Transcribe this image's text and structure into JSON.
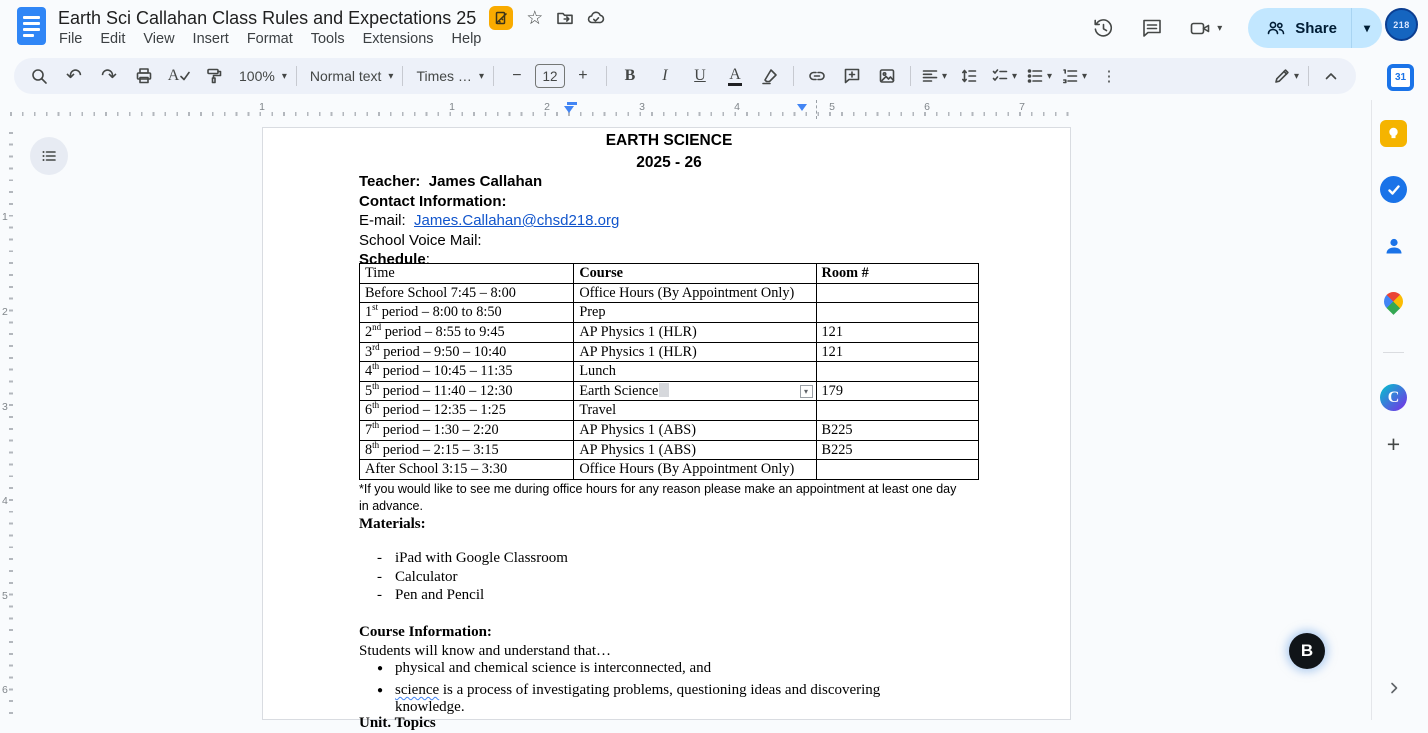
{
  "titlebar": {
    "title": "Earth Sci Callahan Class Rules and Expectations 25",
    "menus": [
      "File",
      "Edit",
      "View",
      "Insert",
      "Format",
      "Tools",
      "Extensions",
      "Help"
    ],
    "share_label": "Share",
    "avatar_badge": "218"
  },
  "toolbar": {
    "zoom_value": "100%",
    "style_value": "Normal text",
    "font_value": "Times …",
    "font_size": "12",
    "bold": "B",
    "italic": "I",
    "underline": "U",
    "text_color": "A",
    "minus": "−",
    "plus": "+",
    "overflow": "⋮",
    "undo": "↶",
    "redo": "↷",
    "spell_letter": "A",
    "star": "☆",
    "calendar_day": "31",
    "canva_letter": "C",
    "brisk_letter": "B",
    "dropdown_glyph": "▾"
  },
  "ruler": {
    "h_numbers": [
      "1",
      "1",
      "2",
      "3",
      "4",
      "5",
      "6",
      "7"
    ],
    "v_numbers": [
      "1",
      "2",
      "3",
      "4",
      "5",
      "6"
    ]
  },
  "document": {
    "heading1": "EARTH SCIENCE",
    "heading2": "2025 - 26",
    "teacher_line": "Teacher:  James Callahan",
    "contact_line": "Contact Information:",
    "email_label": "E-mail:  ",
    "email_link": "James.Callahan@chsd218.org",
    "voicemail_line": "School Voice Mail:",
    "schedule_label": "Schedule",
    "schedule_colon": ":",
    "table": {
      "header": {
        "time": "Time",
        "course": "Course",
        "room": "Room #"
      },
      "rows": [
        {
          "time": {
            "pre": "Before School 7:45 – 8:00"
          },
          "course": "Office Hours (By Appointment Only)",
          "room": ""
        },
        {
          "time": {
            "pre": "1",
            "sup": "st",
            "post": " period – 8:00 to 8:50"
          },
          "course": "Prep",
          "room": ""
        },
        {
          "time": {
            "pre": "2",
            "sup": "nd",
            "post": " period – 8:55 to 9:45"
          },
          "course": "AP Physics 1 (HLR)",
          "room": "121"
        },
        {
          "time": {
            "pre": "3",
            "sup": "rd",
            "post": " period – 9:50 – 10:40"
          },
          "course": "AP Physics 1 (HLR)",
          "room": "121"
        },
        {
          "time": {
            "pre": "4",
            "sup": "th",
            "post": " period – 10:45 – 11:35"
          },
          "course": "Lunch",
          "room": ""
        },
        {
          "time": {
            "pre": "5",
            "sup": "th",
            "post": " period – 11:40 – 12:30"
          },
          "course": "Earth Science",
          "room": "179",
          "selected": true
        },
        {
          "time": {
            "pre": "6",
            "sup": "th",
            "post": " period – 12:35 – 1:25"
          },
          "course": "Travel",
          "room": ""
        },
        {
          "time": {
            "pre": "7",
            "sup": "th",
            "post": " period – 1:30 – 2:20"
          },
          "course": "AP Physics 1 (ABS)",
          "room": "B225"
        },
        {
          "time": {
            "pre": "8",
            "sup": "th",
            "post": " period – 2:15 – 3:15"
          },
          "course": "AP Physics 1 (ABS)",
          "room": "B225"
        },
        {
          "time": {
            "pre": "After School 3:15 – 3:30"
          },
          "course": "Office Hours (By Appointment Only)",
          "room": ""
        }
      ]
    },
    "footnote": "*If you would like to see me during office hours for any reason please make an appointment at least one day in advance.",
    "materials_label": "Materials:",
    "materials": [
      "iPad with Google Classroom",
      "Calculator",
      "Pen and Pencil"
    ],
    "materials_dash": "-",
    "course_info_label": "Course Information:",
    "course_intro": "Students will know and understand that…",
    "bullet_glyph": "●",
    "bullets": [
      {
        "text": "physical and chemical science is interconnected, and"
      },
      {
        "squiggle": "science",
        "text": " is a process of investigating problems, questioning ideas and discovering knowledge."
      }
    ],
    "partial_line": "Unit. Topics"
  },
  "side_panel": {
    "icons": [
      "calendar",
      "keep",
      "tasks",
      "contacts",
      "maps",
      "canva",
      "add"
    ]
  }
}
